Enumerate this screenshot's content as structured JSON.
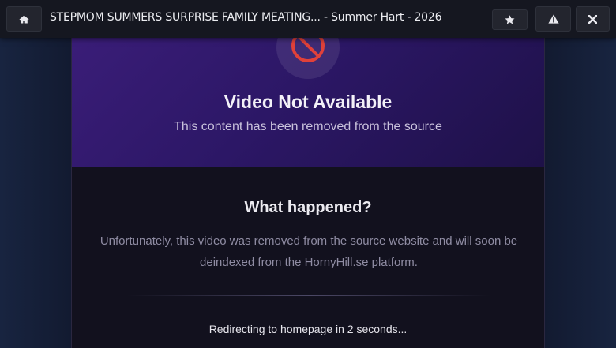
{
  "topbar": {
    "title": "STEPMOM SUMMERS SURPRISE FAMILY MEATING... - Summer Hart - 2026",
    "home_icon": "home-icon",
    "star_icon": "star-icon",
    "warning_icon": "warning-icon",
    "close_icon": "close-icon"
  },
  "hero": {
    "icon": "ban-icon",
    "title": "Video Not Available",
    "subtitle": "This content has been removed from the source"
  },
  "info": {
    "heading": "What happened?",
    "line1": "Unfortunately, this video was removed from the source website and will soon be",
    "line2": "deindexed from the HornyHill.se platform.",
    "redirect": "Redirecting to homepage in 2 seconds..."
  },
  "colors": {
    "hero_accent": "#3a1d78",
    "ban_red": "#e0413a",
    "topbar_bg": "#151720"
  }
}
